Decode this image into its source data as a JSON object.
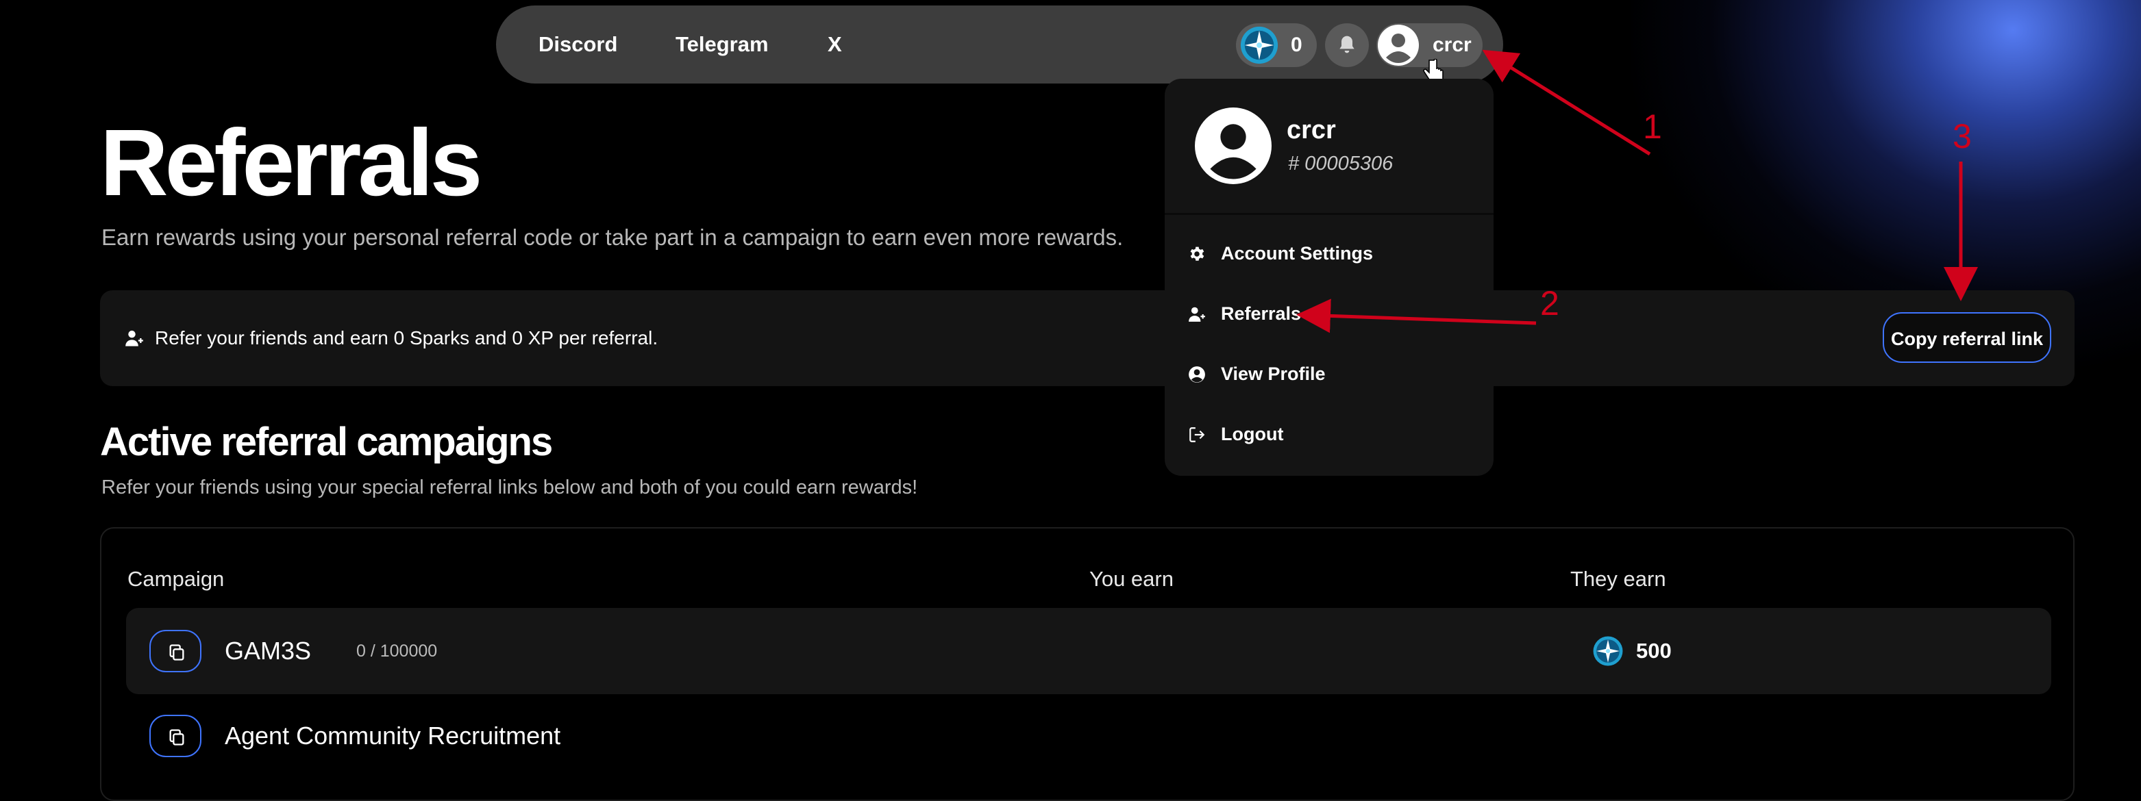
{
  "nav": {
    "links": [
      "Discord",
      "Telegram",
      "X"
    ],
    "sparks_count": "0",
    "username": "crcr"
  },
  "page": {
    "title": "Referrals",
    "subtitle": "Earn rewards using your personal referral code or take part in a campaign to earn even more rewards."
  },
  "banner": {
    "text": "Refer your friends and earn 0 Sparks and 0 XP per referral.",
    "copy_button": "Copy referral link"
  },
  "campaigns": {
    "title": "Active referral campaigns",
    "subtitle": "Refer your friends using your special referral links below and both of you could earn rewards!",
    "columns": [
      "Campaign",
      "You earn",
      "They earn"
    ],
    "rows": [
      {
        "name": "GAM3S",
        "count": "0 / 100000",
        "they_earn": "500"
      },
      {
        "name": "Agent Community Recruitment"
      }
    ]
  },
  "dropdown": {
    "name": "crcr",
    "id": "# 00005306",
    "items": [
      "Account Settings",
      "Referrals",
      "View Profile",
      "Logout"
    ]
  },
  "annotations": {
    "labels": [
      "1",
      "2",
      "3"
    ],
    "color": "#d0021b"
  },
  "colors": {
    "accent": "#3f74ff",
    "background": "#000000",
    "nav_bg": "#3d3d3d"
  }
}
